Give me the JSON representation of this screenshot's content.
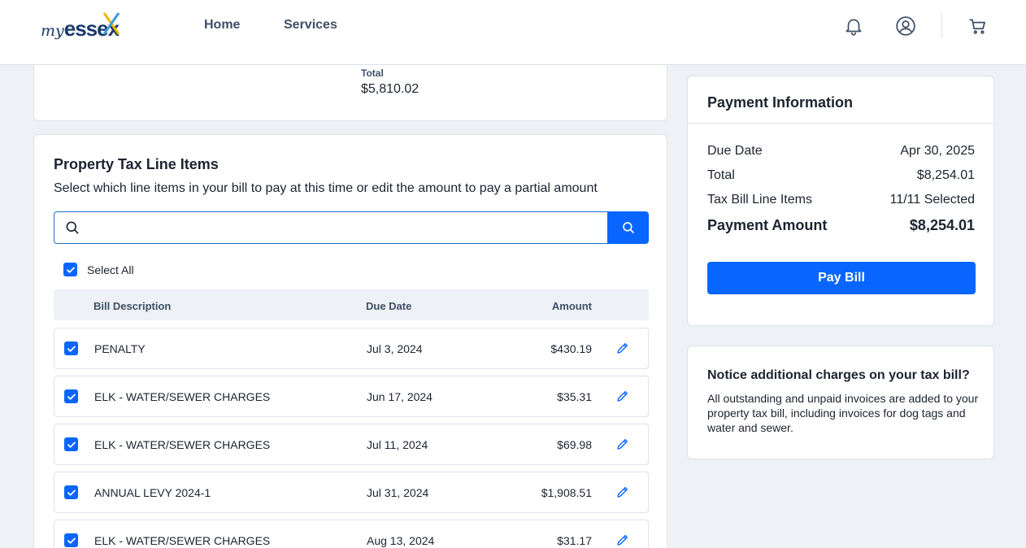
{
  "header": {
    "logo_my": "my",
    "logo_essex": "essex",
    "nav": [
      "Home",
      "Services"
    ],
    "icons": [
      "bell-icon",
      "user-icon",
      "cart-icon"
    ]
  },
  "summary": {
    "total_label": "Total",
    "total_value": "$5,810.02"
  },
  "line_items": {
    "title": "Property Tax Line Items",
    "subtitle": "Select which line items in your bill to pay at this time or edit the amount to pay a partial amount",
    "search": {
      "placeholder": "",
      "value": ""
    },
    "select_all_label": "Select All",
    "select_all_checked": true,
    "columns": {
      "description": "Bill Description",
      "due_date": "Due Date",
      "amount": "Amount"
    },
    "rows": [
      {
        "description": "PENALTY",
        "due_date": "Jul 3, 2024",
        "amount": "$430.19",
        "checked": true
      },
      {
        "description": "ELK - WATER/SEWER CHARGES",
        "due_date": "Jun 17, 2024",
        "amount": "$35.31",
        "checked": true
      },
      {
        "description": "ELK - WATER/SEWER CHARGES",
        "due_date": "Jul 11, 2024",
        "amount": "$69.98",
        "checked": true
      },
      {
        "description": "ANNUAL LEVY 2024-1",
        "due_date": "Jul 31, 2024",
        "amount": "$1,908.51",
        "checked": true
      },
      {
        "description": "ELK - WATER/SEWER CHARGES",
        "due_date": "Aug 13, 2024",
        "amount": "$31.17",
        "checked": true
      }
    ]
  },
  "payment": {
    "title": "Payment Information",
    "due_date_label": "Due Date",
    "due_date_value": "Apr 30, 2025",
    "total_label": "Total",
    "total_value": "$8,254.01",
    "line_items_label": "Tax Bill Line Items",
    "line_items_value": "11/11 Selected",
    "payment_amount_label": "Payment Amount",
    "payment_amount_value": "$8,254.01",
    "pay_button": "Pay Bill"
  },
  "notice": {
    "title": "Notice additional charges on your tax bill?",
    "text": "All outstanding and unpaid invoices are added to your property tax bill, including invoices for dog tags and water and sewer."
  },
  "colors": {
    "primary": "#0866ff",
    "text": "#1c2430",
    "muted": "#3d4f66",
    "background": "#eef1f5"
  }
}
